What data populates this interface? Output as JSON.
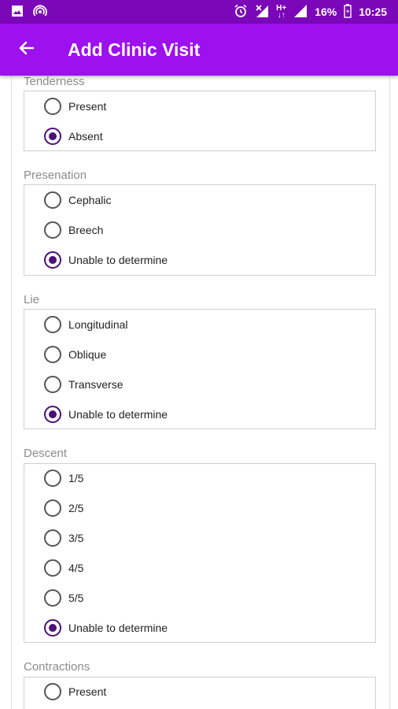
{
  "status_bar": {
    "battery": "16%",
    "time": "10:25",
    "network": "H+",
    "icons": [
      "image-icon",
      "hotspot-icon",
      "alarm-icon",
      "no-signal-icon",
      "data-arrows-icon",
      "signal-icon",
      "battery-icon"
    ]
  },
  "app_bar": {
    "title": "Add Clinic Visit",
    "back_icon": "arrow-left-icon"
  },
  "colors": {
    "status_bar": "#7a07b8",
    "app_bar": "#9c11ee",
    "radio_checked": "#4b1079",
    "section_label": "#8c8c8c"
  },
  "sections": [
    {
      "label": "Tenderness",
      "options": [
        "Present",
        "Absent"
      ],
      "selected": "Absent"
    },
    {
      "label": "Presenation",
      "options": [
        "Cephalic",
        "Breech",
        "Unable to determine"
      ],
      "selected": "Unable to determine"
    },
    {
      "label": "Lie",
      "options": [
        "Longitudinal",
        "Oblique",
        "Transverse",
        "Unable to determine"
      ],
      "selected": "Unable to determine"
    },
    {
      "label": "Descent",
      "options": [
        "1/5",
        "2/5",
        "3/5",
        "4/5",
        "5/5",
        "Unable to determine"
      ],
      "selected": "Unable to determine"
    },
    {
      "label": "Contractions",
      "options": [
        "Present"
      ],
      "selected": null
    }
  ]
}
